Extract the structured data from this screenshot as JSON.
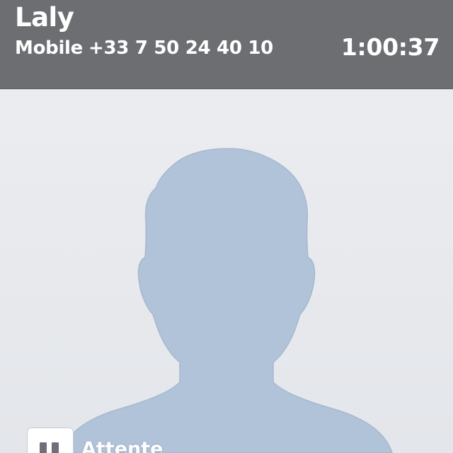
{
  "call": {
    "contact_name": "Laly",
    "number_type": "Mobile",
    "phone_number": "+33 7 50 24 40 10",
    "duration": "1:00:37"
  },
  "avatar": {
    "icon": "person-silhouette-icon",
    "color": "#b1c3d9"
  },
  "controls": {
    "hold": {
      "icon": "pause-icon",
      "label": "Attente"
    }
  },
  "colors": {
    "header_bg": "#6d6e72",
    "header_text": "#ffffff",
    "background": "#e9ebef"
  }
}
